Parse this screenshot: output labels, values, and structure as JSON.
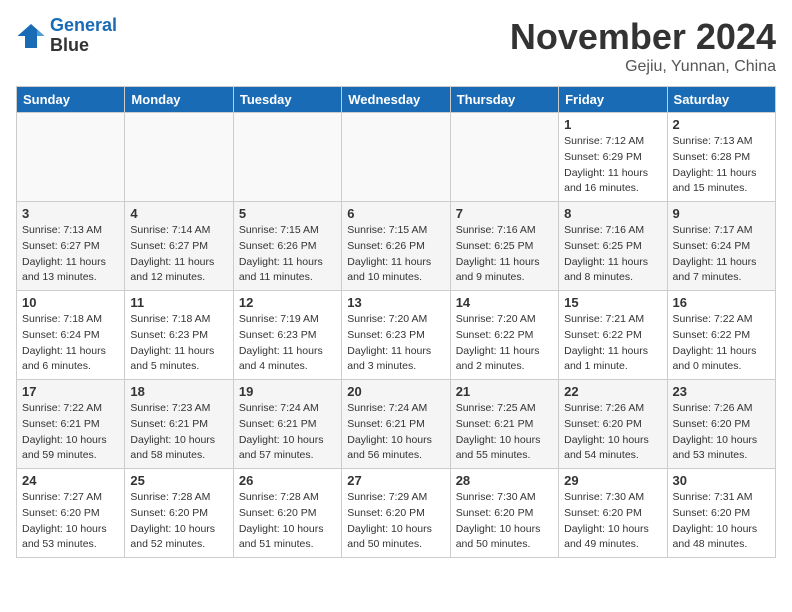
{
  "header": {
    "logo_line1": "General",
    "logo_line2": "Blue",
    "month_title": "November 2024",
    "location": "Gejiu, Yunnan, China"
  },
  "days_of_week": [
    "Sunday",
    "Monday",
    "Tuesday",
    "Wednesday",
    "Thursday",
    "Friday",
    "Saturday"
  ],
  "weeks": [
    {
      "days": [
        {
          "num": "",
          "info": ""
        },
        {
          "num": "",
          "info": ""
        },
        {
          "num": "",
          "info": ""
        },
        {
          "num": "",
          "info": ""
        },
        {
          "num": "",
          "info": ""
        },
        {
          "num": "1",
          "info": "Sunrise: 7:12 AM\nSunset: 6:29 PM\nDaylight: 11 hours\nand 16 minutes."
        },
        {
          "num": "2",
          "info": "Sunrise: 7:13 AM\nSunset: 6:28 PM\nDaylight: 11 hours\nand 15 minutes."
        }
      ]
    },
    {
      "days": [
        {
          "num": "3",
          "info": "Sunrise: 7:13 AM\nSunset: 6:27 PM\nDaylight: 11 hours\nand 13 minutes."
        },
        {
          "num": "4",
          "info": "Sunrise: 7:14 AM\nSunset: 6:27 PM\nDaylight: 11 hours\nand 12 minutes."
        },
        {
          "num": "5",
          "info": "Sunrise: 7:15 AM\nSunset: 6:26 PM\nDaylight: 11 hours\nand 11 minutes."
        },
        {
          "num": "6",
          "info": "Sunrise: 7:15 AM\nSunset: 6:26 PM\nDaylight: 11 hours\nand 10 minutes."
        },
        {
          "num": "7",
          "info": "Sunrise: 7:16 AM\nSunset: 6:25 PM\nDaylight: 11 hours\nand 9 minutes."
        },
        {
          "num": "8",
          "info": "Sunrise: 7:16 AM\nSunset: 6:25 PM\nDaylight: 11 hours\nand 8 minutes."
        },
        {
          "num": "9",
          "info": "Sunrise: 7:17 AM\nSunset: 6:24 PM\nDaylight: 11 hours\nand 7 minutes."
        }
      ]
    },
    {
      "days": [
        {
          "num": "10",
          "info": "Sunrise: 7:18 AM\nSunset: 6:24 PM\nDaylight: 11 hours\nand 6 minutes."
        },
        {
          "num": "11",
          "info": "Sunrise: 7:18 AM\nSunset: 6:23 PM\nDaylight: 11 hours\nand 5 minutes."
        },
        {
          "num": "12",
          "info": "Sunrise: 7:19 AM\nSunset: 6:23 PM\nDaylight: 11 hours\nand 4 minutes."
        },
        {
          "num": "13",
          "info": "Sunrise: 7:20 AM\nSunset: 6:23 PM\nDaylight: 11 hours\nand 3 minutes."
        },
        {
          "num": "14",
          "info": "Sunrise: 7:20 AM\nSunset: 6:22 PM\nDaylight: 11 hours\nand 2 minutes."
        },
        {
          "num": "15",
          "info": "Sunrise: 7:21 AM\nSunset: 6:22 PM\nDaylight: 11 hours\nand 1 minute."
        },
        {
          "num": "16",
          "info": "Sunrise: 7:22 AM\nSunset: 6:22 PM\nDaylight: 11 hours\nand 0 minutes."
        }
      ]
    },
    {
      "days": [
        {
          "num": "17",
          "info": "Sunrise: 7:22 AM\nSunset: 6:21 PM\nDaylight: 10 hours\nand 59 minutes."
        },
        {
          "num": "18",
          "info": "Sunrise: 7:23 AM\nSunset: 6:21 PM\nDaylight: 10 hours\nand 58 minutes."
        },
        {
          "num": "19",
          "info": "Sunrise: 7:24 AM\nSunset: 6:21 PM\nDaylight: 10 hours\nand 57 minutes."
        },
        {
          "num": "20",
          "info": "Sunrise: 7:24 AM\nSunset: 6:21 PM\nDaylight: 10 hours\nand 56 minutes."
        },
        {
          "num": "21",
          "info": "Sunrise: 7:25 AM\nSunset: 6:21 PM\nDaylight: 10 hours\nand 55 minutes."
        },
        {
          "num": "22",
          "info": "Sunrise: 7:26 AM\nSunset: 6:20 PM\nDaylight: 10 hours\nand 54 minutes."
        },
        {
          "num": "23",
          "info": "Sunrise: 7:26 AM\nSunset: 6:20 PM\nDaylight: 10 hours\nand 53 minutes."
        }
      ]
    },
    {
      "days": [
        {
          "num": "24",
          "info": "Sunrise: 7:27 AM\nSunset: 6:20 PM\nDaylight: 10 hours\nand 53 minutes."
        },
        {
          "num": "25",
          "info": "Sunrise: 7:28 AM\nSunset: 6:20 PM\nDaylight: 10 hours\nand 52 minutes."
        },
        {
          "num": "26",
          "info": "Sunrise: 7:28 AM\nSunset: 6:20 PM\nDaylight: 10 hours\nand 51 minutes."
        },
        {
          "num": "27",
          "info": "Sunrise: 7:29 AM\nSunset: 6:20 PM\nDaylight: 10 hours\nand 50 minutes."
        },
        {
          "num": "28",
          "info": "Sunrise: 7:30 AM\nSunset: 6:20 PM\nDaylight: 10 hours\nand 50 minutes."
        },
        {
          "num": "29",
          "info": "Sunrise: 7:30 AM\nSunset: 6:20 PM\nDaylight: 10 hours\nand 49 minutes."
        },
        {
          "num": "30",
          "info": "Sunrise: 7:31 AM\nSunset: 6:20 PM\nDaylight: 10 hours\nand 48 minutes."
        }
      ]
    }
  ]
}
